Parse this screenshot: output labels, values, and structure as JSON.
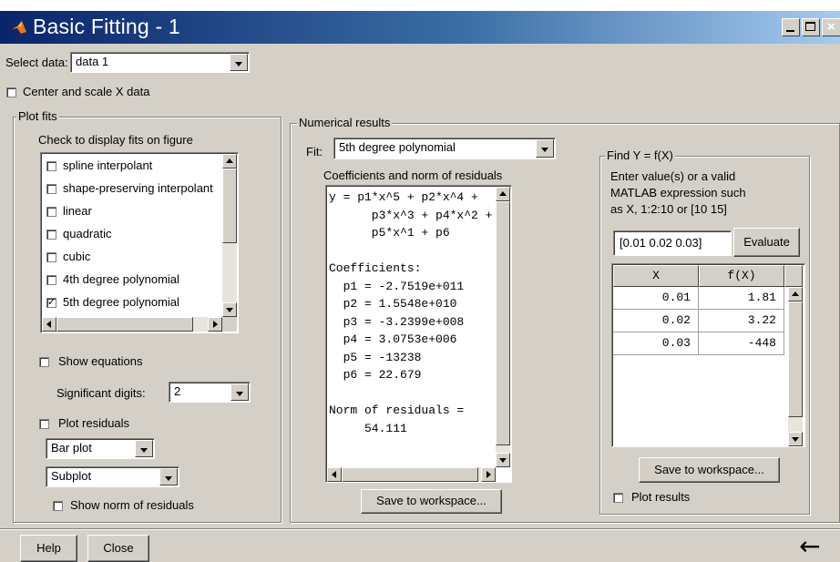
{
  "window": {
    "title": "Basic Fitting - 1",
    "controls": [
      "minimize",
      "maximize",
      "close"
    ]
  },
  "select_data": {
    "label": "Select data:",
    "value": "data 1"
  },
  "center_scale": {
    "label": "Center and scale X data",
    "checked": false
  },
  "plot_fits": {
    "group_title": "Plot fits",
    "instruction": "Check to display fits on figure",
    "fits": [
      {
        "label": "spline interpolant",
        "checked": false
      },
      {
        "label": "shape-preserving interpolant",
        "checked": false
      },
      {
        "label": "linear",
        "checked": false
      },
      {
        "label": "quadratic",
        "checked": false
      },
      {
        "label": "cubic",
        "checked": false
      },
      {
        "label": "4th degree polynomial",
        "checked": false
      },
      {
        "label": "5th degree polynomial",
        "checked": true
      }
    ],
    "show_equations": {
      "label": "Show equations",
      "checked": false
    },
    "significant_digits": {
      "label": "Significant digits:",
      "value": "2"
    },
    "plot_residuals": {
      "label": "Plot residuals",
      "checked": false
    },
    "residual_plot_type": "Bar plot",
    "residual_location": "Subplot",
    "show_norm": {
      "label": "Show norm of residuals",
      "checked": false
    }
  },
  "numerical": {
    "group_title": "Numerical results",
    "fit_label": "Fit:",
    "fit_value": "5th degree polynomial",
    "coeff_label": "Coefficients and norm of residuals",
    "lines": [
      "y = p1*x^5 + p2*x^4 +",
      "      p3*x^3 + p4*x^2 +",
      "      p5*x^1 + p6",
      "",
      "Coefficients:",
      "  p1 = -2.7519e+011",
      "  p2 = 1.5548e+010",
      "  p3 = -3.2399e+008",
      "  p4 = 3.0753e+006",
      "  p5 = -13238",
      "  p6 = 22.679",
      "",
      "Norm of residuals =",
      "     54.111"
    ],
    "save_button": "Save to workspace..."
  },
  "find_y": {
    "group_title": "Find Y = f(X)",
    "instruction_lines": [
      "Enter value(s) or a valid",
      "MATLAB expression such",
      "as X, 1:2:10 or [10 15]"
    ],
    "input_value": "[0.01 0.02 0.03]",
    "evaluate_button": "Evaluate",
    "table": {
      "headers": [
        "X",
        "f(X)"
      ],
      "rows": [
        [
          "0.01",
          "1.81"
        ],
        [
          "0.02",
          "3.22"
        ],
        [
          "0.03",
          "-448"
        ]
      ]
    },
    "save_button": "Save to workspace...",
    "plot_results": {
      "label": "Plot results",
      "checked": false
    }
  },
  "footer": {
    "help": "Help",
    "close": "Close",
    "arrow": "←"
  }
}
